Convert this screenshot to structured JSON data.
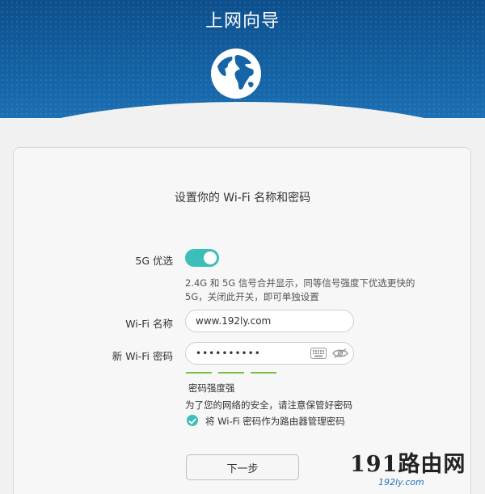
{
  "header": {
    "title": "上网向导"
  },
  "card": {
    "title": "设置你的 Wi-Fi 名称和密码",
    "band_steering": {
      "label": "5G 优选",
      "on": true,
      "description_line1": "2.4G 和 5G 信号合并显示，同等信号强度下优选更快的",
      "description_line2": "5G，关闭此开关，即可单独设置"
    },
    "wifi_name": {
      "label": "Wi-Fi 名称",
      "value": "www.192ly.com"
    },
    "wifi_password": {
      "label": "新 Wi-Fi 密码",
      "value": "••••••••••",
      "strength_label": "密码强度强"
    },
    "security_note": "为了您的网络的安全，请注意保管好密码",
    "reuse_checkbox": {
      "label": "将 Wi-Fi 密码作为路由器管理密码",
      "checked": true
    },
    "next_button": "下一步"
  },
  "watermark": {
    "main": "191路由网",
    "sub": "192ly.com"
  },
  "colors": {
    "header": "#1565a8",
    "accent": "#3bbfb6",
    "strength": "#77c043"
  },
  "icons": [
    "globe-icon",
    "keyboard-icon",
    "eye-hidden-icon",
    "checkmark-icon"
  ]
}
